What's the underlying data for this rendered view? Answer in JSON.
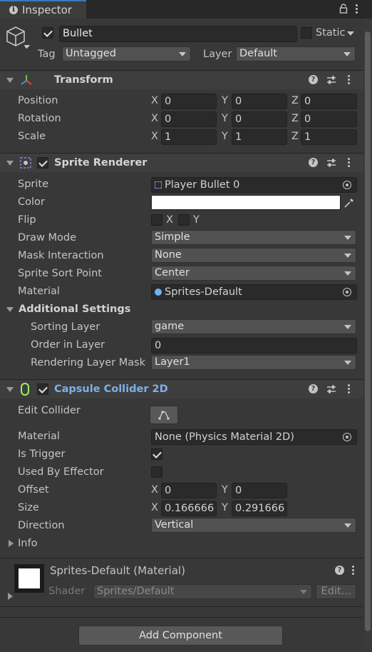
{
  "window": {
    "tab_label": "Inspector"
  },
  "object": {
    "name": "Bullet",
    "static_label": "Static",
    "tag_label": "Tag",
    "tag_value": "Untagged",
    "layer_label": "Layer",
    "layer_value": "Default"
  },
  "transform": {
    "title": "Transform",
    "rows": [
      {
        "label": "Position",
        "x": "0",
        "y": "0",
        "z": "0"
      },
      {
        "label": "Rotation",
        "x": "0",
        "y": "0",
        "z": "0"
      },
      {
        "label": "Scale",
        "x": "1",
        "y": "1",
        "z": "1"
      }
    ],
    "axes": {
      "x": "X",
      "y": "Y",
      "z": "Z"
    }
  },
  "sprite_renderer": {
    "title": "Sprite Renderer",
    "sprite_label": "Sprite",
    "sprite_value": "Player Bullet 0",
    "color_label": "Color",
    "color_value": "#ffffff",
    "flip_label": "Flip",
    "flip_x": "X",
    "flip_y": "Y",
    "draw_mode_label": "Draw Mode",
    "draw_mode_value": "Simple",
    "mask_label": "Mask Interaction",
    "mask_value": "None",
    "sort_point_label": "Sprite Sort Point",
    "sort_point_value": "Center",
    "material_label": "Material",
    "material_value": "Sprites-Default",
    "additional_label": "Additional Settings",
    "sorting_layer_label": "Sorting Layer",
    "sorting_layer_value": "game",
    "order_label": "Order in Layer",
    "order_value": "0",
    "rendering_mask_label": "Rendering Layer Mask",
    "rendering_mask_value": "Layer1"
  },
  "collider": {
    "title": "Capsule Collider 2D",
    "edit_label": "Edit Collider",
    "material_label": "Material",
    "material_value": "None (Physics Material 2D)",
    "trigger_label": "Is Trigger",
    "is_trigger": true,
    "effector_label": "Used By Effector",
    "used_by_effector": false,
    "offset_label": "Offset",
    "offset_x": "0",
    "offset_y": "0",
    "size_label": "Size",
    "size_x": "0.166666",
    "size_y": "0.291666",
    "direction_label": "Direction",
    "direction_value": "Vertical",
    "info_label": "Info"
  },
  "material_asset": {
    "title": "Sprites-Default (Material)",
    "shader_label": "Shader",
    "shader_value": "Sprites/Default",
    "edit_label": "Edit..."
  },
  "footer": {
    "add_component_label": "Add Component"
  },
  "colors": {
    "accent": "#3a79bb",
    "collider_title": "#7db1e8",
    "collider_icon": "#9cf25e"
  }
}
